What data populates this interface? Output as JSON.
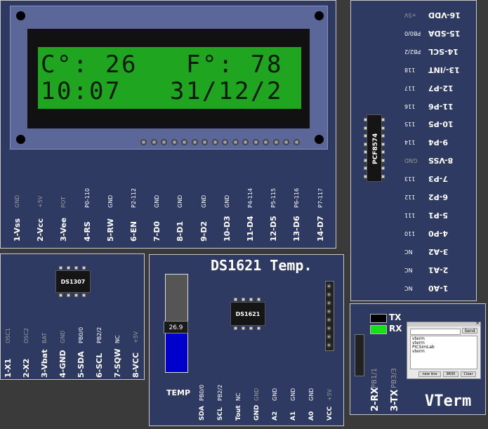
{
  "lcd": {
    "line1": [
      "C",
      "°",
      ":",
      " ",
      "2",
      "6",
      " ",
      " ",
      " ",
      "F",
      "°",
      ":",
      " ",
      "7",
      "8",
      " "
    ],
    "line2": [
      "1",
      "0",
      ":",
      "0",
      "7",
      " ",
      " ",
      " ",
      "3",
      "1",
      "/",
      "1",
      "2",
      "/",
      "2",
      " "
    ],
    "colors": {
      "bezel": "#5b6699",
      "frame": "#111111",
      "screen": "#1fa51f",
      "text": "#0b1a0b"
    }
  },
  "lcd_pins": [
    {
      "name": "1-Vss",
      "signal": "GND",
      "dim": true
    },
    {
      "name": "2-Vcc",
      "signal": "+5V",
      "dim": true
    },
    {
      "name": "3-Vee",
      "signal": "POT",
      "dim": true
    },
    {
      "name": "4-RS",
      "signal": "P0-110",
      "dim": false
    },
    {
      "name": "5-RW",
      "signal": "GND",
      "dim": false
    },
    {
      "name": "6-EN",
      "signal": "P2-112",
      "dim": false
    },
    {
      "name": "7-D0",
      "signal": "GND",
      "dim": false
    },
    {
      "name": "8-D1",
      "signal": "GND",
      "dim": false
    },
    {
      "name": "9-D2",
      "signal": "GND",
      "dim": false
    },
    {
      "name": "10-D3",
      "signal": "GND",
      "dim": false
    },
    {
      "name": "11-D4",
      "signal": "P4-114",
      "dim": false
    },
    {
      "name": "12-D5",
      "signal": "P5-115",
      "dim": false
    },
    {
      "name": "13-D6",
      "signal": "P6-116",
      "dim": false
    },
    {
      "name": "14-D7",
      "signal": "P7-117",
      "dim": false
    }
  ],
  "pcf": {
    "chip": "PCF8574",
    "pins": [
      {
        "name": "16-VDD",
        "signal": "+5V",
        "dim": true
      },
      {
        "name": "15-SDA",
        "signal": "PB0/0",
        "dim": false
      },
      {
        "name": "14-SCL",
        "signal": "PB2/2",
        "dim": false
      },
      {
        "name": "13-/INT",
        "signal": "118",
        "dim": false
      },
      {
        "name": "12-P7",
        "signal": "117",
        "dim": false
      },
      {
        "name": "11-P6",
        "signal": "116",
        "dim": false
      },
      {
        "name": "10-P5",
        "signal": "115",
        "dim": false
      },
      {
        "name": "9-P4",
        "signal": "114",
        "dim": false
      },
      {
        "name": "8-VSS",
        "signal": "GND",
        "dim": true
      },
      {
        "name": "7-P3",
        "signal": "113",
        "dim": false
      },
      {
        "name": "6-P2",
        "signal": "112",
        "dim": false
      },
      {
        "name": "5-P1",
        "signal": "111",
        "dim": false
      },
      {
        "name": "4-P0",
        "signal": "110",
        "dim": false
      },
      {
        "name": "3-A2",
        "signal": "NC",
        "dim": false
      },
      {
        "name": "2-A1",
        "signal": "NC",
        "dim": false
      },
      {
        "name": "1-A0",
        "signal": "NC",
        "dim": false
      }
    ]
  },
  "rtc": {
    "chip": "DS1307",
    "pins": [
      {
        "name": "1-X1",
        "signal": "OSC1",
        "dim": true
      },
      {
        "name": "2-X2",
        "signal": "OSC2",
        "dim": true
      },
      {
        "name": "3-Vbat",
        "signal": "BAT",
        "dim": true
      },
      {
        "name": "4-GND",
        "signal": "GND",
        "dim": true
      },
      {
        "name": "5-SDA",
        "signal": "PB0/0",
        "dim": false
      },
      {
        "name": "6-SCL",
        "signal": "PB2/2",
        "dim": false
      },
      {
        "name": "7-SQW",
        "signal": "NC",
        "dim": false
      },
      {
        "name": "8-VCC",
        "signal": "+5V",
        "dim": true
      }
    ]
  },
  "temp": {
    "title": "DS1621 Temp.",
    "chip": "DS1621",
    "value": "26.9",
    "level": 0.45,
    "label": "TEMP",
    "pins": [
      {
        "name": "SDA",
        "signal": "PB0/0",
        "dim": false
      },
      {
        "name": "SCL",
        "signal": "PB2/2",
        "dim": false
      },
      {
        "name": "Tout",
        "signal": "NC",
        "dim": false
      },
      {
        "name": "GND",
        "signal": "GND",
        "dim": true
      },
      {
        "name": "A2",
        "signal": "GND",
        "dim": false
      },
      {
        "name": "A1",
        "signal": "GND",
        "dim": false
      },
      {
        "name": "A0",
        "signal": "GND",
        "dim": false
      },
      {
        "name": "VCC",
        "signal": "+5V",
        "dim": true
      }
    ]
  },
  "vterm": {
    "title": "VTerm",
    "tx_label": "TX",
    "rx_label": "RX",
    "rx_color": "#18e018",
    "pins": [
      {
        "name": "2-RX",
        "signal": "PB1/1",
        "dim": true
      },
      {
        "name": "3-TX",
        "signal": "PB3/3",
        "dim": true
      }
    ],
    "window": {
      "send_label": "Send",
      "lines": [
        "vterm",
        "vterm",
        "PICSimLab",
        "vterm"
      ],
      "buttons": [
        "new line",
        "9600",
        "Clear"
      ]
    }
  }
}
